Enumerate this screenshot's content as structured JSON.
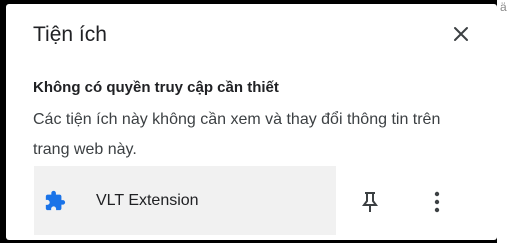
{
  "background": {
    "edge_glyph": "ä"
  },
  "popup": {
    "title": "Tiện ích",
    "close_icon": "close-icon",
    "section": {
      "heading": "Không có quyền truy cập cần thiết",
      "description": "Các tiện ích này không cần xem và thay đổi thông tin trên trang web này."
    },
    "extensions": [
      {
        "name": "VLT Extension",
        "icon": "puzzle-piece-icon",
        "icon_color": "#1a73e8",
        "pin_icon": "pin-icon",
        "menu_icon": "more-vert-icon"
      }
    ]
  }
}
